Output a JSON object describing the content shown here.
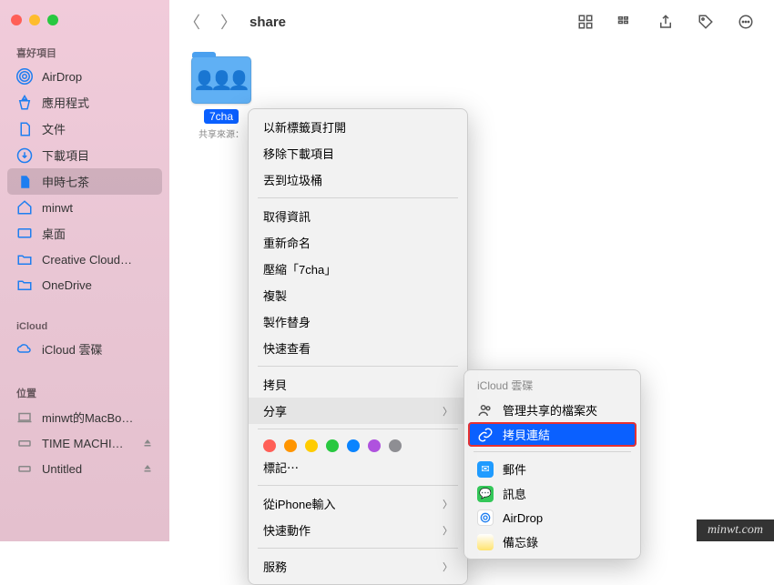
{
  "window": {
    "title": "share"
  },
  "sidebar": {
    "s1": {
      "header": "喜好項目",
      "items": [
        {
          "label": "AirDrop"
        },
        {
          "label": "應用程式"
        },
        {
          "label": "文件"
        },
        {
          "label": "下載項目"
        },
        {
          "label": "申時七茶"
        },
        {
          "label": "minwt"
        },
        {
          "label": "桌面"
        },
        {
          "label": "Creative Cloud…"
        },
        {
          "label": "OneDrive"
        }
      ]
    },
    "s2": {
      "header": "iCloud",
      "items": [
        {
          "label": "iCloud 雲碟"
        }
      ]
    },
    "s3": {
      "header": "位置",
      "items": [
        {
          "label": "minwt的MacBo…"
        },
        {
          "label": "TIME MACHI…"
        },
        {
          "label": "Untitled"
        }
      ]
    }
  },
  "folder": {
    "name": "7cha",
    "sub": "共享來源："
  },
  "menu": {
    "g1": [
      "以新標籤頁打開",
      "移除下載項目",
      "丟到垃圾桶"
    ],
    "g2": [
      "取得資訊",
      "重新命名",
      "壓縮「7cha」",
      "複製",
      "製作替身",
      "快速查看"
    ],
    "g3": [
      "拷貝",
      "分享"
    ],
    "g4": "標記⋯",
    "g5": [
      "從iPhone輸入",
      "快速動作"
    ],
    "g6": "服務"
  },
  "submenu": {
    "header": "iCloud 雲碟",
    "items": [
      {
        "label": "管理共享的檔案夾"
      },
      {
        "label": "拷貝連結"
      },
      {
        "label": "郵件"
      },
      {
        "label": "訊息"
      },
      {
        "label": "AirDrop"
      },
      {
        "label": "備忘錄"
      }
    ]
  },
  "tagcolors": [
    "#ff5f57",
    "#ff9500",
    "#ffcc00",
    "#28c840",
    "#0a84ff",
    "#af52de",
    "#8e8e93"
  ],
  "watermark": "minwt.com"
}
